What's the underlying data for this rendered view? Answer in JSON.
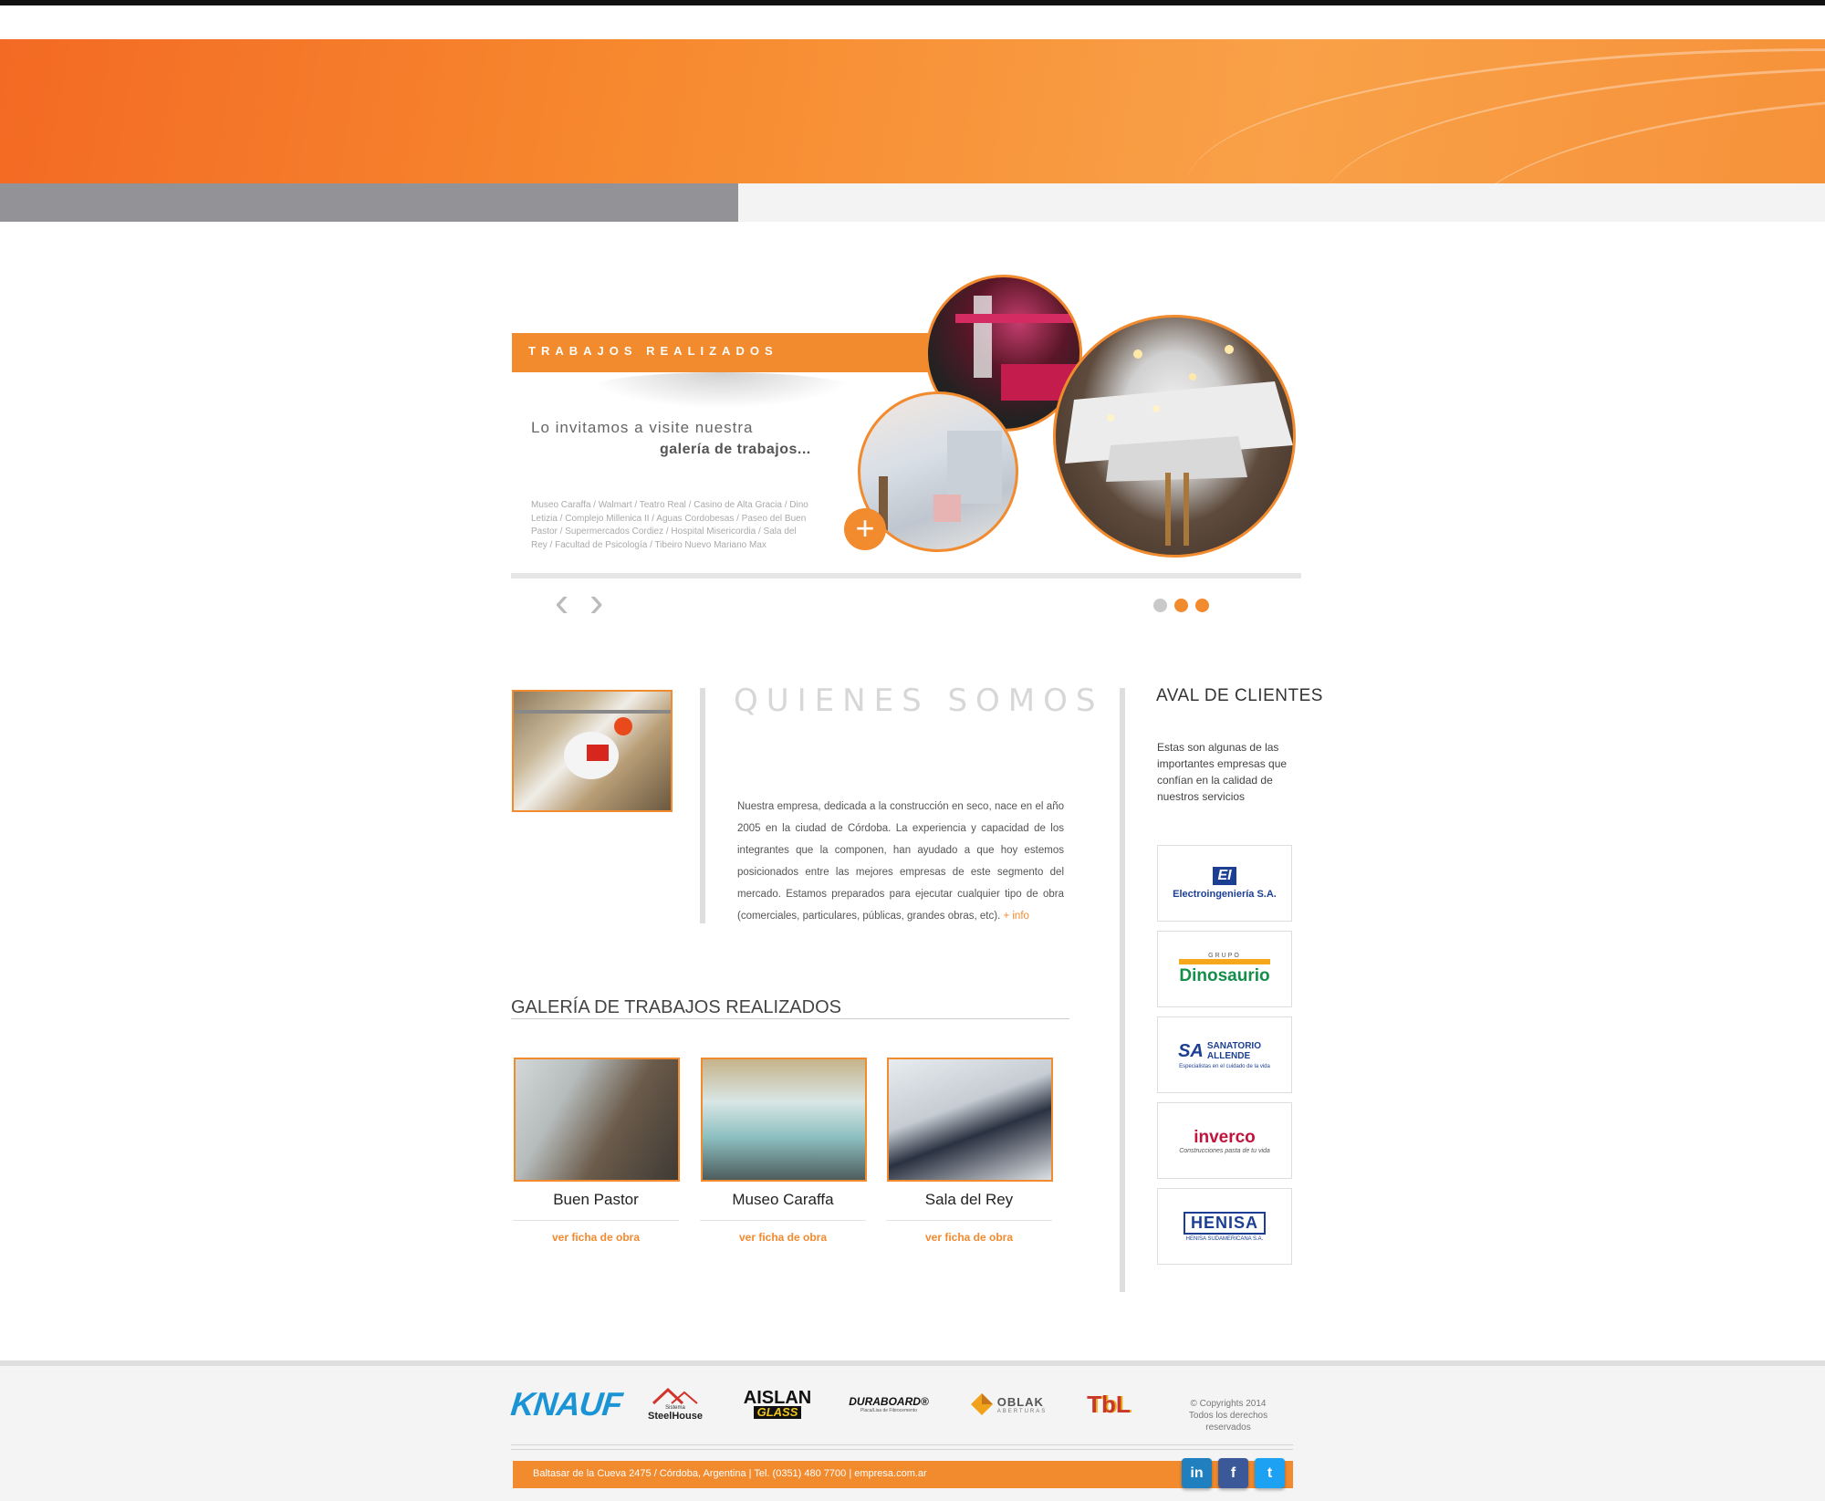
{
  "hero": {
    "tab": "TRABAJOS REALIZADOS",
    "line1": "Lo invitamos a visite nuestra",
    "line2": "galería de trabajos...",
    "list": "Museo Caraffa / Walmart / Teatro Real / Casino de Alta Gracia / Dino Letizia / Complejo Millenica II / Aguas Cordobesas / Paseo del Buen Pastor / Supermercados Cordiez / Hospital Misericordia / Sala del Rey / Facultad de Psicología / Tibeiro Nuevo Mariano Max",
    "plus": "+",
    "prev": "‹",
    "next": "›",
    "slide_count": 3,
    "active_dot": 1
  },
  "about": {
    "title": "QUIENES SOMOS",
    "text": "Nuestra empresa, dedicada a la construcción en seco, nace en el año 2005 en la ciudad de Córdoba. La experiencia y capacidad de los integrantes que la componen, han ayudado a que hoy estemos posicionados entre las mejores empresas de este segmento del mercado. Estamos preparados para ejecutar cualquier tipo de obra (comerciales, particulares, públicas, grandes obras, etc).",
    "more": "+ info"
  },
  "gallery": {
    "title": "GALERÍA DE TRABAJOS REALIZADOS",
    "items": [
      {
        "caption": "Buen Pastor",
        "link": "ver ficha de obra"
      },
      {
        "caption": "Museo Caraffa",
        "link": "ver ficha de obra"
      },
      {
        "caption": "Sala del Rey",
        "link": "ver ficha de obra"
      }
    ]
  },
  "clients": {
    "title": "AVAL DE CLIENTES",
    "text": "Estas son algunas de las importantes empresas que confían en la calidad de nuestros servicios",
    "logos": [
      {
        "mark": "EI",
        "name": "Electroingeniería S.A."
      },
      {
        "mark": "GRUPO",
        "name": "Dinosaurio"
      },
      {
        "mark": "SA",
        "name": "SANATORIO ALLENDE",
        "sub": "Especialistas en el cuidado de la vida"
      },
      {
        "mark": "inverco",
        "name": "Construcciones pasta de tu vida"
      },
      {
        "mark": "HENISA",
        "name": "HENISA SUDAMERICANA S.A."
      }
    ]
  },
  "footer": {
    "brands": [
      {
        "name": "KNAUF"
      },
      {
        "name": "SteelHouse",
        "sub": "Sistema"
      },
      {
        "name": "AISLAN",
        "sub": "GLASS"
      },
      {
        "name": "DURABOARD®",
        "sub": "Placa/Lisa de Fibrocemento"
      },
      {
        "name": "OBLAK",
        "sub": "ABERTURAS"
      },
      {
        "name": "TbL"
      }
    ],
    "copyright1": "© Copyrights 2014",
    "copyright2": "Todos los derechos reservados",
    "address": "Baltasar de la Cueva 2475 / Córdoba, Argentina  |  Tel. (0351) 480 7700  |  empresa.com.ar",
    "social": [
      "in",
      "f",
      "t"
    ]
  },
  "colors": {
    "accent": "#f28a2e",
    "gray_bar": "#929297"
  }
}
